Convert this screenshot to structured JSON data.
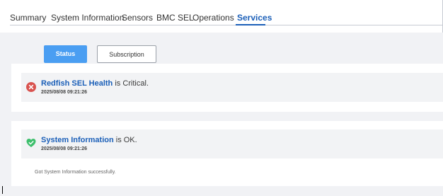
{
  "tabs": [
    {
      "label": "Summary",
      "active": false
    },
    {
      "label": "System Information",
      "active": false
    },
    {
      "label": "Sensors",
      "active": false
    },
    {
      "label": "BMC SEL",
      "active": false
    },
    {
      "label": "Operations",
      "active": false
    },
    {
      "label": "Services",
      "active": true
    }
  ],
  "subtabs": {
    "status_label": "Status",
    "subscription_label": "Subscription",
    "active": "Status"
  },
  "status_items": [
    {
      "icon": "x-circle-icon",
      "name": "Redfish SEL Health",
      "suffix": "is Critical.",
      "timestamp": "2025/08/08 09:21:26",
      "color": "#d9534f"
    },
    {
      "icon": "heart-check-icon",
      "name": "System Information",
      "suffix": "is OK.",
      "timestamp": "2025/08/08 09:21:26",
      "color": "#3dbf6c",
      "detail": "Got System Information successfully."
    }
  ],
  "colors": {
    "accent": "#1b5fb8",
    "primary_button": "#4a9ef2",
    "critical": "#d9534f",
    "ok": "#3dbf6c",
    "page_background": "#f1f2f5"
  }
}
